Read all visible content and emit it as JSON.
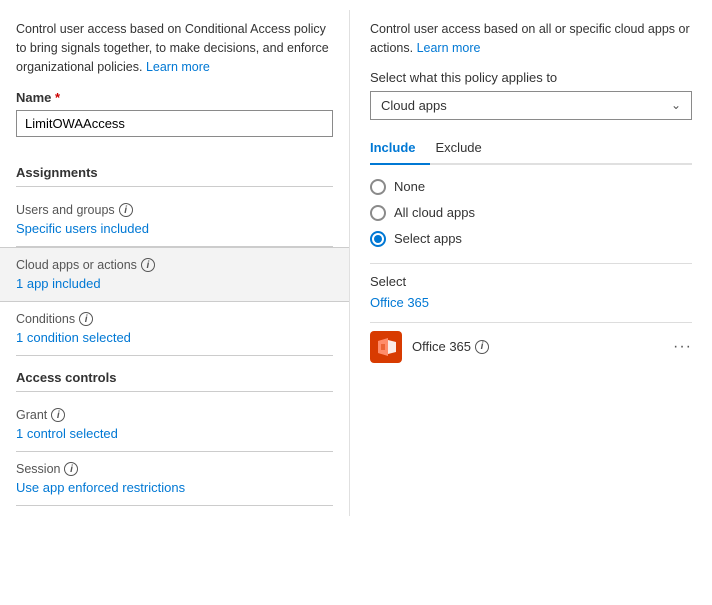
{
  "left": {
    "intro": "Control user access based on Conditional Access policy to bring signals together, to make decisions, and enforce organizational policies.",
    "intro_link": "Learn more",
    "name_label": "Name",
    "name_required": "*",
    "name_value": "LimitOWAAccess",
    "assignments_header": "Assignments",
    "users_groups_title": "Users and groups",
    "users_groups_link": "Specific users included",
    "cloud_apps_title": "Cloud apps or actions",
    "cloud_apps_link": "1 app included",
    "conditions_title": "Conditions",
    "conditions_link": "1 condition selected",
    "access_controls_header": "Access controls",
    "grant_title": "Grant",
    "grant_link": "1 control selected",
    "session_title": "Session",
    "session_link": "Use app enforced restrictions"
  },
  "right": {
    "intro": "Control user access based on all or specific cloud apps or actions.",
    "intro_link": "Learn more",
    "applies_label": "Select what this policy applies to",
    "dropdown_value": "Cloud apps",
    "tab_include": "Include",
    "tab_exclude": "Exclude",
    "radio_none": "None",
    "radio_all": "All cloud apps",
    "radio_select": "Select apps",
    "select_label": "Select",
    "select_link": "Office 365",
    "app_name": "Office 365",
    "ellipsis": "···",
    "icons": {
      "info": "i",
      "chevron_down": "⌄"
    }
  }
}
